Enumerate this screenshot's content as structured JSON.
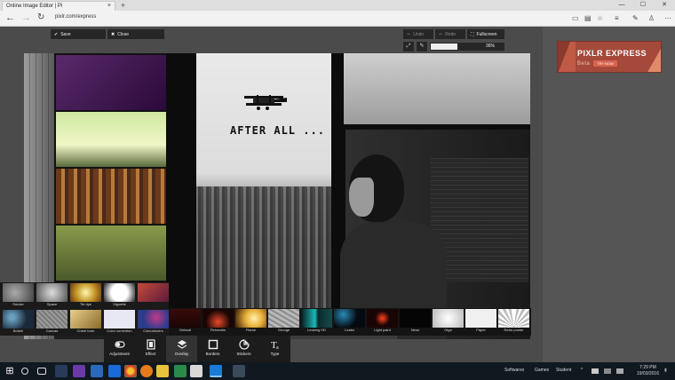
{
  "browser": {
    "tab_title": "Online Image Editor | Pi",
    "tab_close": "×",
    "new_tab": "+",
    "url": "pixlr.com/express",
    "window_buttons": [
      "—",
      "☐",
      "✕"
    ],
    "nav": {
      "back": "←",
      "forward": "→",
      "refresh": "↻"
    }
  },
  "editor": {
    "save_label": "Save",
    "close_label": "Close",
    "undo_label": "Undo",
    "redo_label": "Redo",
    "fullscreen_label": "Fullscreen",
    "zoom_value": "36%",
    "zoom_fraction": 0.36
  },
  "canvas": {
    "headline": "AFTER ALL ..."
  },
  "ad": {
    "title": "PIXLR EXPRESS",
    "beta": "Beta",
    "button": "TRY NOW"
  },
  "presets_left": [
    {
      "label": "Smoke",
      "color": "#7b7b7b"
    },
    {
      "label": "Space",
      "color": "#b3b3b3"
    },
    {
      "label": "Tie dye",
      "color": "#c79a2c"
    },
    {
      "label": "Vignette",
      "color": "#f4f4f4"
    },
    {
      "label": "",
      "color": "#8a2c3a"
    },
    {
      "label": "Bokeh",
      "color": "#2e4a5a"
    },
    {
      "label": "Canvas",
      "color": "#9a9a9a"
    },
    {
      "label": "Chem burn",
      "color": "#c8a84e"
    },
    {
      "label": "Color correction",
      "color": "#e8e8f4"
    },
    {
      "label": "Colourlovers",
      "color": "#2a3c8a"
    }
  ],
  "presets_row": [
    {
      "label": "Default",
      "color": "#2a0a0a"
    },
    {
      "label": "Fireworks",
      "color": "#6a1410"
    },
    {
      "label": "Flame",
      "color": "#e8b23a"
    },
    {
      "label": "Grunge",
      "color": "#a8a8a8"
    },
    {
      "label": "Leaking HD",
      "color": "#1a8a8a"
    },
    {
      "label": "Leaks",
      "color": "#0c2a3a"
    },
    {
      "label": "Light paint",
      "color": "#3a0a0a"
    },
    {
      "label": "Neon",
      "color": "#050505"
    },
    {
      "label": "Olga",
      "color": "#e4e4e4"
    },
    {
      "label": "Paper",
      "color": "#f0f0f0"
    },
    {
      "label": "Retro poster",
      "color": "#d8d8d8"
    }
  ],
  "bottom_tools": [
    {
      "label": "Adjustment",
      "icon": "adjustment-icon"
    },
    {
      "label": "Effect",
      "icon": "effect-icon"
    },
    {
      "label": "Overlay",
      "icon": "overlay-icon"
    },
    {
      "label": "Borders",
      "icon": "borders-icon"
    },
    {
      "label": "Stickers",
      "icon": "stickers-icon"
    },
    {
      "label": "Type",
      "icon": "type-icon"
    }
  ],
  "taskbar": {
    "items": [
      "Softwares",
      "Games",
      "Student"
    ],
    "time": "7:29 PM",
    "date": "19/03/2016"
  },
  "colors": {
    "accent": "#a5493a",
    "toolbar": "#262626",
    "taskbar": "#101820"
  }
}
